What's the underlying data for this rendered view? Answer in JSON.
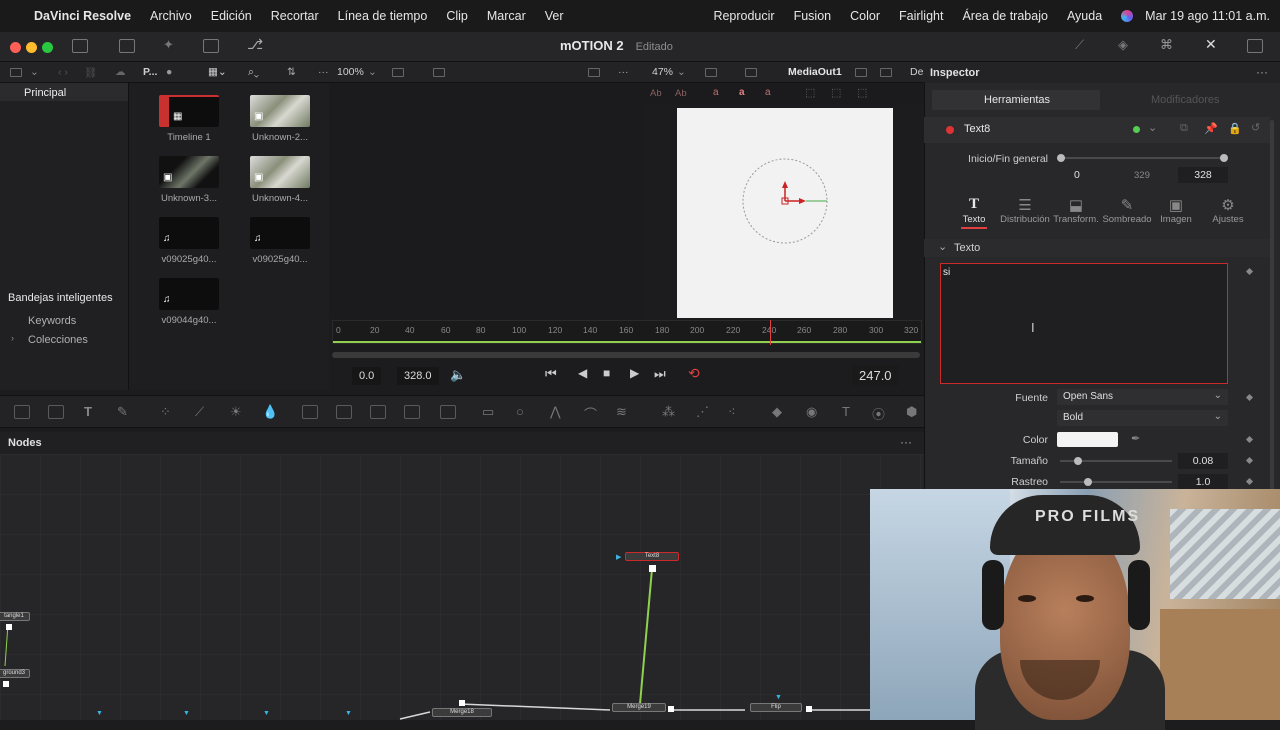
{
  "menubar": {
    "app": "DaVinci Resolve",
    "items": [
      "Archivo",
      "Edición",
      "Recortar",
      "Línea de tiempo",
      "Clip",
      "Marcar",
      "Ver"
    ],
    "right_items": [
      "Reproducir",
      "Fusion",
      "Color",
      "Fairlight",
      "Área de trabajo",
      "Ayuda"
    ],
    "datetime": "Mar 19 ago 11:01 a.m."
  },
  "titlebar": {
    "project": "mOTION 2",
    "status": "Editado"
  },
  "toolbar": {
    "panel_short": "P...",
    "zoom_media": "100%",
    "zoom_viewer": "47%",
    "viewer_node": "MediaOut1",
    "de_label": "De",
    "inspector_title": "Inspector"
  },
  "media_pool": {
    "left": {
      "principal": "Principal",
      "smart_bins": "Bandejas inteligentes",
      "keywords": "Keywords",
      "collections": "Colecciones"
    },
    "clips": [
      {
        "name": "Timeline 1",
        "kind": "timeline"
      },
      {
        "name": "Unknown-2...",
        "kind": "image"
      },
      {
        "name": "Unknown-3...",
        "kind": "image"
      },
      {
        "name": "Unknown-4...",
        "kind": "image"
      },
      {
        "name": "v09025g40...",
        "kind": "audio"
      },
      {
        "name": "v09025g40...",
        "kind": "audio"
      },
      {
        "name": "v09044g40...",
        "kind": "audio"
      }
    ]
  },
  "viewer": {
    "ruler_ticks": [
      "0",
      "20",
      "40",
      "60",
      "80",
      "100",
      "120",
      "140",
      "160",
      "180",
      "200",
      "220",
      "240",
      "260",
      "280",
      "300",
      "320"
    ],
    "in_point": "0.0",
    "out_point": "328.0",
    "current_frame": "247.0",
    "text_buttons": [
      "Ab",
      "Ab",
      "a",
      "a",
      "a"
    ]
  },
  "nodes": {
    "title": "Nodes",
    "items": [
      {
        "label": "Text8"
      },
      {
        "label": "Merge19"
      },
      {
        "label": "Merge18"
      },
      {
        "label": "Flip"
      },
      {
        "label": "tangle1"
      },
      {
        "label": "ground3"
      }
    ]
  },
  "inspector": {
    "tabs": [
      "Herramientas",
      "Modificadores"
    ],
    "node_name": "Text8",
    "range_label": "Inicio/Fin general",
    "range_start": "0",
    "range_mid": "329",
    "range_end": "328",
    "subtabs": [
      "Texto",
      "Distribución",
      "Transform.",
      "Sombreado",
      "Imagen",
      "Ajustes"
    ],
    "section": "Texto",
    "text_value": "si",
    "font_label": "Fuente",
    "font_family": "Open Sans",
    "font_style": "Bold",
    "color_label": "Color",
    "size_label": "Tamaño",
    "size_value": "0.08",
    "tracking_label": "Rastreo",
    "tracking_value": "1.0"
  },
  "webcam": {
    "cap_text": "PRO FILMS"
  },
  "colors": {
    "accent_red": "#e24040",
    "node_green": "#8fd14f",
    "selection_red": "#cc2a2a"
  }
}
